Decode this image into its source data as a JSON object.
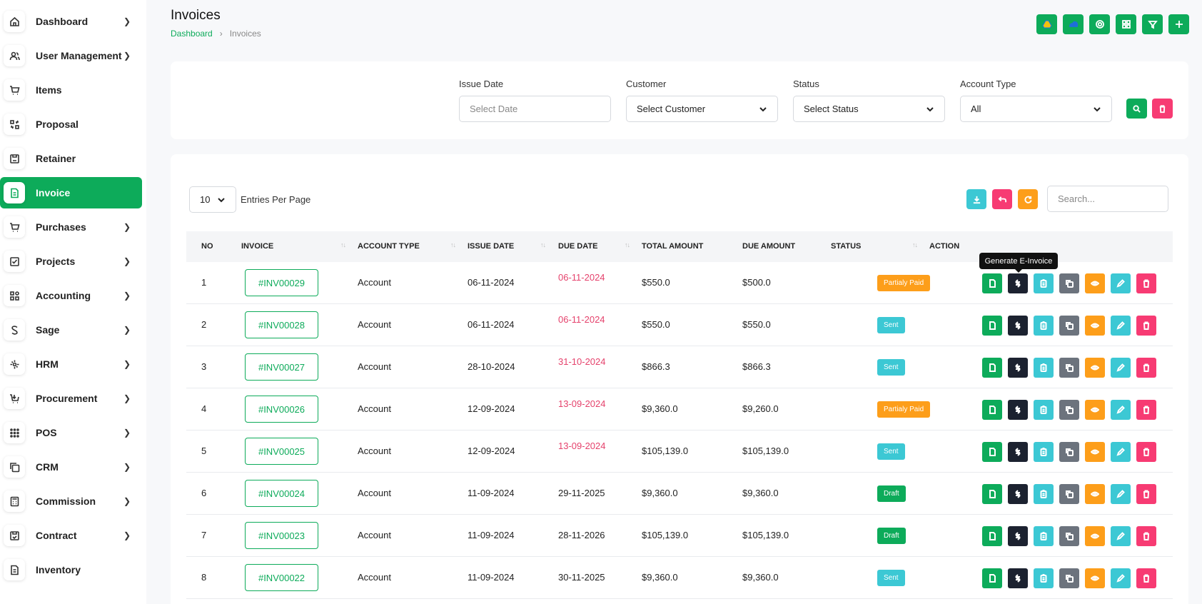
{
  "sidebar": {
    "items": [
      {
        "label": "Dashboard",
        "icon": "home-icon",
        "chevron": true
      },
      {
        "label": "User Management",
        "icon": "users-icon",
        "chevron": true
      },
      {
        "label": "Items",
        "icon": "cart-icon",
        "chevron": false
      },
      {
        "label": "Proposal",
        "icon": "proposal-icon",
        "chevron": false
      },
      {
        "label": "Retainer",
        "icon": "retainer-icon",
        "chevron": false
      },
      {
        "label": "Invoice",
        "icon": "invoice-icon",
        "chevron": false,
        "active": true
      },
      {
        "label": "Purchases",
        "icon": "cart-icon",
        "chevron": true
      },
      {
        "label": "Projects",
        "icon": "check-square-icon",
        "chevron": true
      },
      {
        "label": "Accounting",
        "icon": "grid-icon",
        "chevron": true
      },
      {
        "label": "Sage",
        "icon": "s-letter-icon",
        "chevron": true
      },
      {
        "label": "HRM",
        "icon": "hrm-icon",
        "chevron": true
      },
      {
        "label": "Procurement",
        "icon": "procurement-icon",
        "chevron": true
      },
      {
        "label": "POS",
        "icon": "dots-grid-icon",
        "chevron": true
      },
      {
        "label": "CRM",
        "icon": "copy-icon",
        "chevron": true
      },
      {
        "label": "Commission",
        "icon": "calculator-icon",
        "chevron": true
      },
      {
        "label": "Contract",
        "icon": "contract-icon",
        "chevron": true
      },
      {
        "label": "Inventory",
        "icon": "document-icon",
        "chevron": false
      }
    ]
  },
  "header": {
    "title": "Invoices",
    "breadcrumb": [
      "Dashboard",
      "Invoices"
    ],
    "actions": [
      "drive-icon",
      "onedrive-icon",
      "settings-icon",
      "grid-icon",
      "filter-icon",
      "plus-icon"
    ]
  },
  "filters": {
    "issue_date": {
      "label": "Issue Date",
      "placeholder": "Select Date"
    },
    "customer": {
      "label": "Customer",
      "value": "Select Customer"
    },
    "status": {
      "label": "Status",
      "value": "Select Status"
    },
    "account_type": {
      "label": "Account Type",
      "value": "All"
    }
  },
  "table_controls": {
    "entries_value": "10",
    "entries_label": "Entries Per Page",
    "search_placeholder": "Search..."
  },
  "table": {
    "columns": [
      "NO",
      "INVOICE",
      "ACCOUNT TYPE",
      "ISSUE DATE",
      "DUE DATE",
      "TOTAL AMOUNT",
      "DUE AMOUNT",
      "STATUS",
      "ACTION"
    ],
    "rows": [
      {
        "no": "1",
        "invoice": "#INV00029",
        "account_type": "Account",
        "issue_date": "06-11-2024",
        "due_date": "06-11-2024",
        "due_overdue": true,
        "total": "$550.0",
        "due_amount": "$500.0",
        "status": "Partialy Paid"
      },
      {
        "no": "2",
        "invoice": "#INV00028",
        "account_type": "Account",
        "issue_date": "06-11-2024",
        "due_date": "06-11-2024",
        "due_overdue": true,
        "total": "$550.0",
        "due_amount": "$550.0",
        "status": "Sent"
      },
      {
        "no": "3",
        "invoice": "#INV00027",
        "account_type": "Account",
        "issue_date": "28-10-2024",
        "due_date": "31-10-2024",
        "due_overdue": true,
        "total": "$866.3",
        "due_amount": "$866.3",
        "status": "Sent"
      },
      {
        "no": "4",
        "invoice": "#INV00026",
        "account_type": "Account",
        "issue_date": "12-09-2024",
        "due_date": "13-09-2024",
        "due_overdue": true,
        "total": "$9,360.0",
        "due_amount": "$9,260.0",
        "status": "Partialy Paid"
      },
      {
        "no": "5",
        "invoice": "#INV00025",
        "account_type": "Account",
        "issue_date": "12-09-2024",
        "due_date": "13-09-2024",
        "due_overdue": true,
        "total": "$105,139.0",
        "due_amount": "$105,139.0",
        "status": "Sent"
      },
      {
        "no": "6",
        "invoice": "#INV00024",
        "account_type": "Account",
        "issue_date": "11-09-2024",
        "due_date": "29-11-2025",
        "due_overdue": false,
        "total": "$9,360.0",
        "due_amount": "$9,360.0",
        "status": "Draft"
      },
      {
        "no": "7",
        "invoice": "#INV00023",
        "account_type": "Account",
        "issue_date": "11-09-2024",
        "due_date": "28-11-2026",
        "due_overdue": false,
        "total": "$105,139.0",
        "due_amount": "$105,139.0",
        "status": "Draft"
      },
      {
        "no": "8",
        "invoice": "#INV00022",
        "account_type": "Account",
        "issue_date": "11-09-2024",
        "due_date": "30-11-2025",
        "due_overdue": false,
        "total": "$9,360.0",
        "due_amount": "$9,360.0",
        "status": "Sent"
      }
    ]
  },
  "tooltip": "Generate E-Invoice",
  "colors": {
    "brand": "#0dab5a",
    "overdue": "#e5426c",
    "partial": "#fd9e1a",
    "sent": "#3cc8d4",
    "draft": "#0dab5a",
    "dark": "#1c2230",
    "gray": "#6c737d",
    "pink": "#f73b73"
  }
}
